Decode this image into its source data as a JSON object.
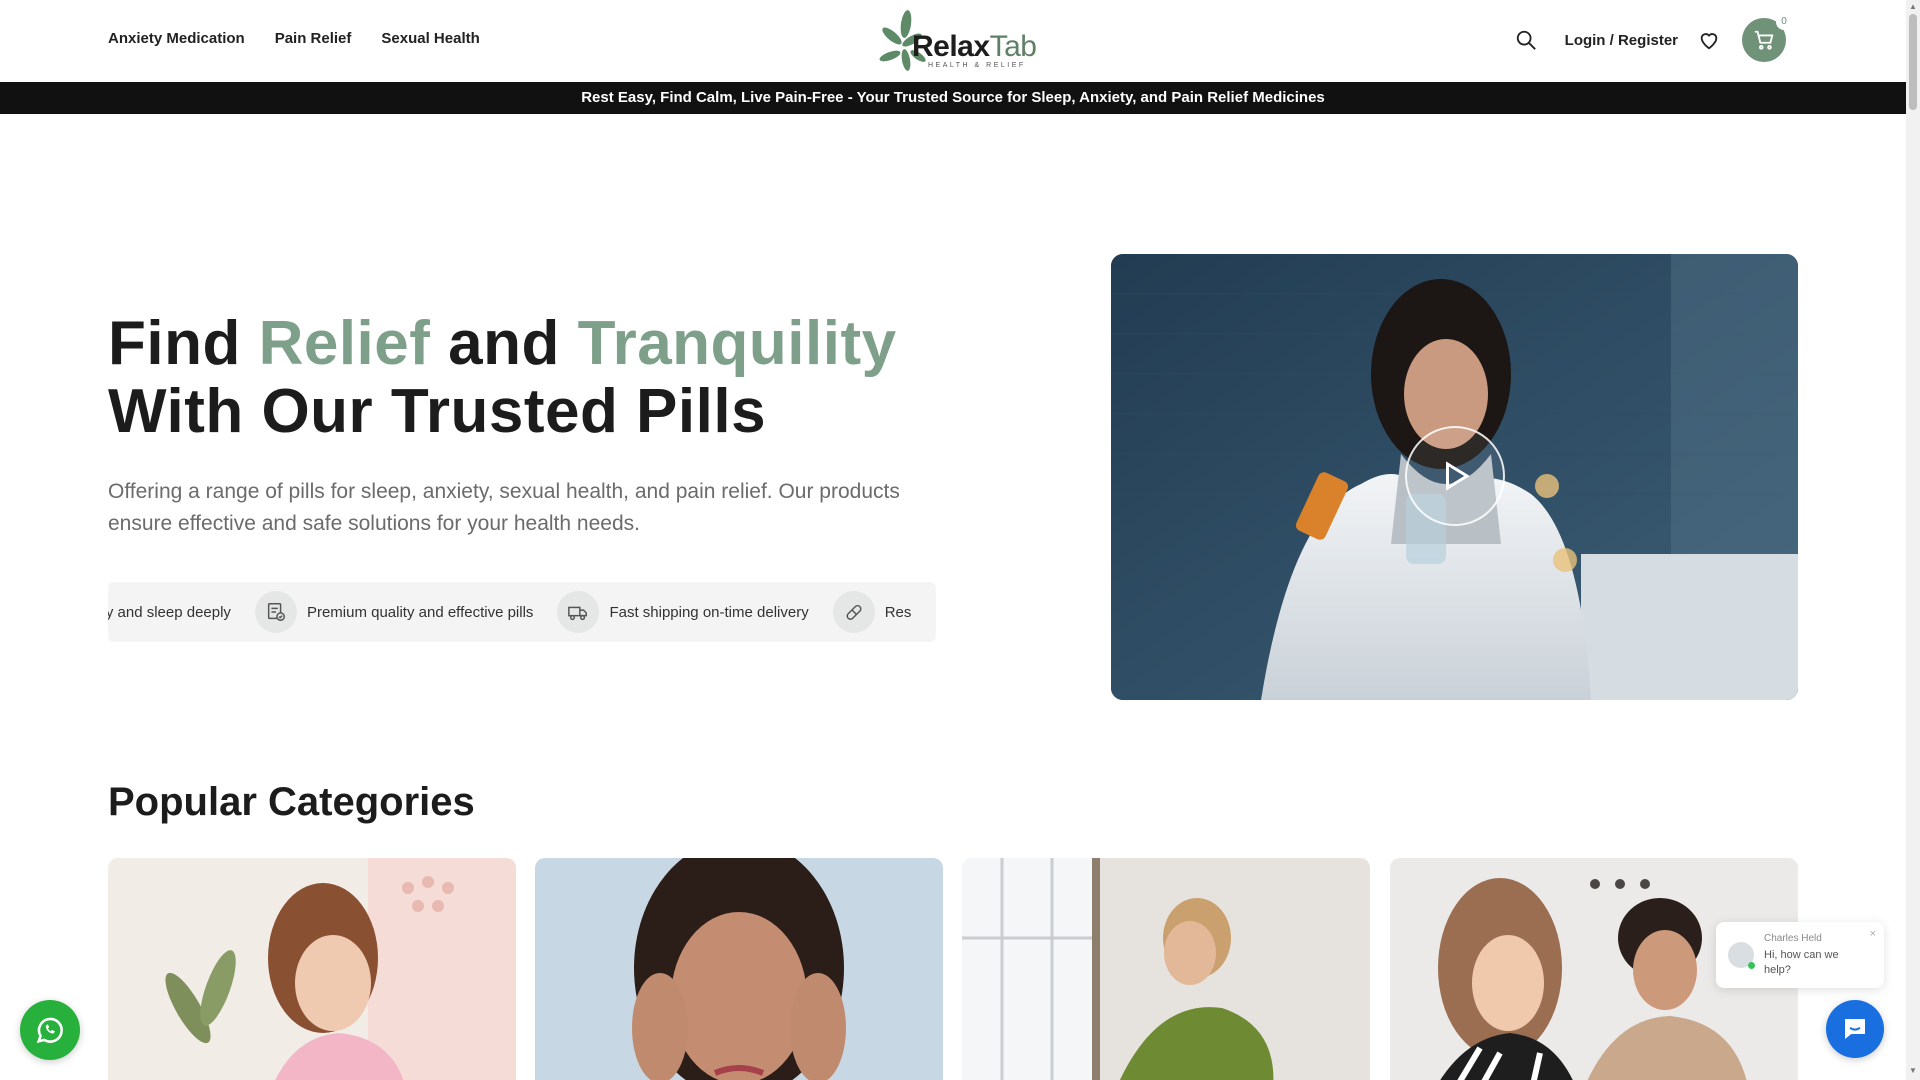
{
  "nav": {
    "items": [
      {
        "label": "Anxiety Medication"
      },
      {
        "label": "Pain Relief"
      },
      {
        "label": "Sexual Health"
      }
    ]
  },
  "logo": {
    "name_part1": "Relax",
    "name_part2": "Tab",
    "tagline": "HEALTH & RELIEF"
  },
  "header": {
    "login_label": "Login / Register",
    "cart_count": "0"
  },
  "announcement": "Rest Easy, Find Calm, Live Pain-Free - Your Trusted Source for Sleep, Anxiety, and Pain Relief Medicines",
  "hero": {
    "title_find": "Find",
    "title_relief": "Relief",
    "title_and": "and",
    "title_tranquility": "Tranquility",
    "title_line2": "With Our Trusted Pills",
    "description": "Offering a range of pills for sleep, anxiety, sexual health, and pain relief. Our products ensure effective and safe solutions for your health needs.",
    "features": [
      {
        "label": "asy and sleep deeply",
        "icon": "moon-icon"
      },
      {
        "label": "Premium quality and effective pills",
        "icon": "quality-badge-icon"
      },
      {
        "label": "Fast shipping on-time delivery",
        "icon": "truck-icon"
      },
      {
        "label": "Res",
        "icon": "pill-icon"
      }
    ]
  },
  "categories": {
    "title": "Popular Categories"
  },
  "chat": {
    "agent_name": "Charles Held",
    "message": "Hi, how can we help?",
    "close": "×"
  },
  "colors": {
    "accent": "#7ea08a",
    "cart": "#6f9279",
    "topbar": "#111111",
    "whatsapp": "#27b13c",
    "chat": "#1a6fe0"
  }
}
